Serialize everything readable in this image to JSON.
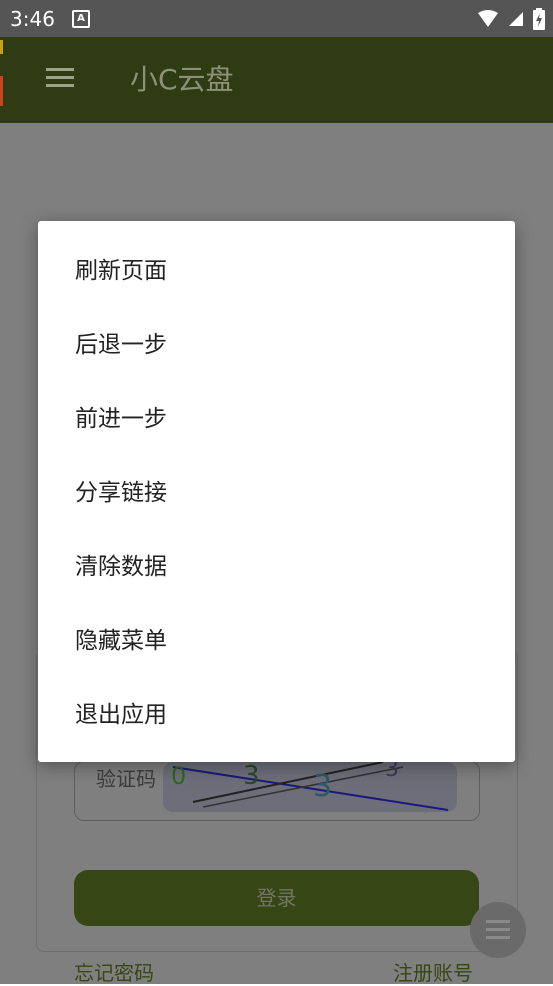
{
  "status_bar": {
    "time": "3:46",
    "notification_icon": "a-letter-icon",
    "icons": [
      "wifi-icon",
      "signal-icon",
      "battery-icon"
    ]
  },
  "app_bar": {
    "title": "小C云盘",
    "menu_icon": "hamburger-icon"
  },
  "login_form": {
    "captcha_label": "验证码",
    "login_button": "登录",
    "forgot_password": "忘记密码",
    "register": "注册账号"
  },
  "popup_menu": {
    "items": [
      {
        "label": "刷新页面"
      },
      {
        "label": "后退一步"
      },
      {
        "label": "前进一步"
      },
      {
        "label": "分享链接"
      },
      {
        "label": "清除数据"
      },
      {
        "label": "隐藏菜单"
      },
      {
        "label": "退出应用"
      }
    ]
  },
  "colors": {
    "app_bar": "#2f3c13",
    "status_bar": "#555555",
    "accent": "#364614",
    "overlay_background": "#7f7f7f"
  }
}
